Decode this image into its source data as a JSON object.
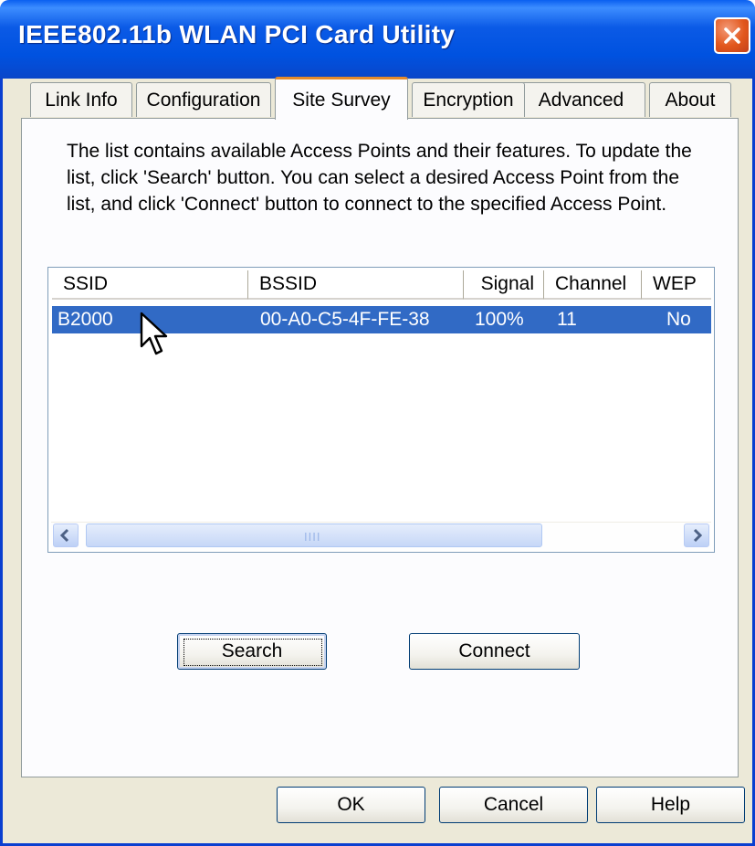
{
  "window": {
    "title": "IEEE802.11b WLAN PCI Card Utility"
  },
  "tabs": [
    {
      "label": "Link Info"
    },
    {
      "label": "Configuration"
    },
    {
      "label": "Site Survey"
    },
    {
      "label": "Encryption"
    },
    {
      "label": "Advanced"
    },
    {
      "label": "About"
    }
  ],
  "active_tab": "Site Survey",
  "description": "The list contains available Access Points and their features. To update the list, click 'Search' button. You can select a desired Access Point from the list, and click 'Connect' button to connect to the specified Access Point.",
  "list": {
    "columns": [
      "SSID",
      "BSSID",
      "Signal",
      "Channel",
      "WEP"
    ],
    "rows": [
      {
        "ssid": "B2000",
        "bssid": "00-A0-C5-4F-FE-38",
        "signal": "100%",
        "channel": "11",
        "wep": "No",
        "selected": true
      }
    ],
    "scroll_grip": "IIII"
  },
  "buttons": {
    "search": "Search",
    "connect": "Connect",
    "ok": "OK",
    "cancel": "Cancel",
    "help": "Help"
  },
  "colors": {
    "title_bar": "#0055e5",
    "selection": "#316ac5",
    "active_tab_accent": "#e68b2c",
    "close_button": "#e2571d"
  }
}
